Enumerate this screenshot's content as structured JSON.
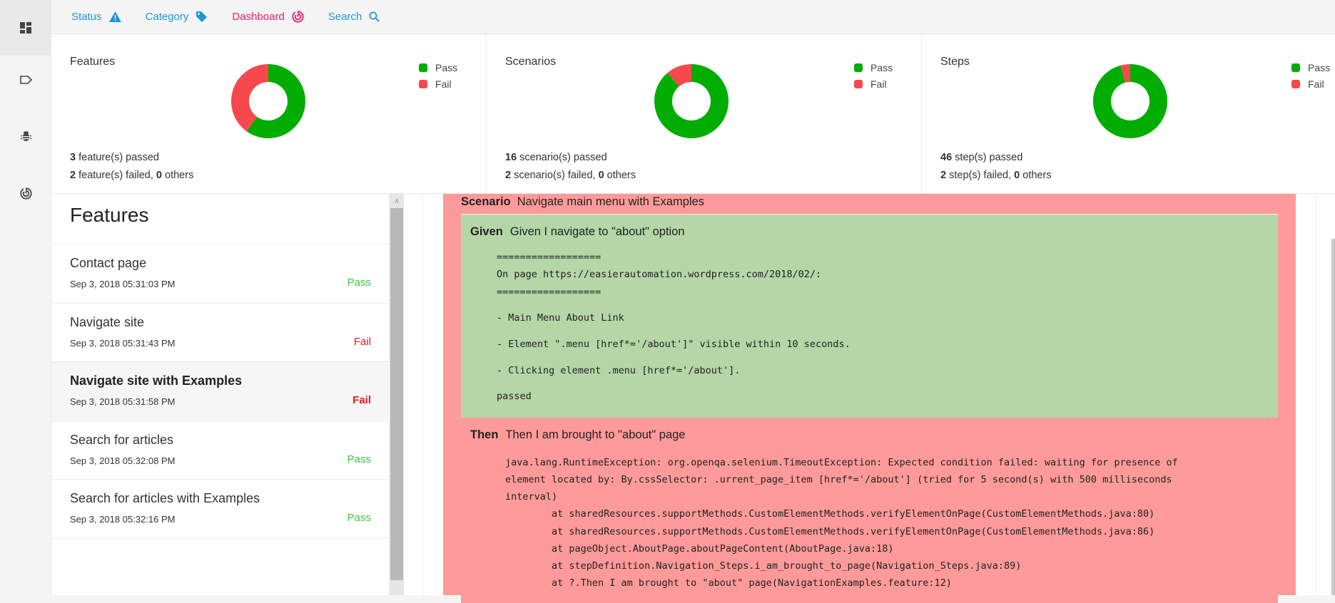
{
  "nav": {
    "items": [
      {
        "label": "Status",
        "icon": "warning-icon",
        "color": "#1e96dc"
      },
      {
        "label": "Category",
        "icon": "tag-icon",
        "color": "#1e96dc"
      },
      {
        "label": "Dashboard",
        "icon": "radar-icon",
        "color": "#e91e63"
      },
      {
        "label": "Search",
        "icon": "search-icon",
        "color": "#1e96dc"
      }
    ]
  },
  "sidebar": {
    "items": [
      {
        "icon": "dashboard-icon",
        "active": true
      },
      {
        "icon": "label-icon",
        "active": false
      },
      {
        "icon": "bug-icon",
        "active": false
      },
      {
        "icon": "radar-icon",
        "active": false
      }
    ]
  },
  "colors": {
    "pass": "#00ad00",
    "fail": "#f7484e"
  },
  "dashboard": {
    "features": {
      "title": "Features",
      "legend": [
        "Pass",
        "Fail"
      ],
      "passed": "3",
      "passed_text": " feature(s) passed",
      "failed": "2",
      "failed_text": " feature(s) failed, ",
      "others": "0",
      "others_text": " others"
    },
    "scenarios": {
      "title": "Scenarios",
      "legend": [
        "Pass",
        "Fail"
      ],
      "passed": "16",
      "passed_text": " scenario(s) passed",
      "failed": "2",
      "failed_text": " scenario(s) failed, ",
      "others": "0",
      "others_text": " others"
    },
    "steps": {
      "title": "Steps",
      "legend": [
        "Pass",
        "Fail"
      ],
      "passed": "46",
      "passed_text": " step(s) passed",
      "failed": "2",
      "failed_text": " step(s) failed, ",
      "others": "0",
      "others_text": " others"
    }
  },
  "chart_data": [
    {
      "type": "pie",
      "title": "Features",
      "categories": [
        "Pass",
        "Fail"
      ],
      "values": [
        3,
        2
      ],
      "donut": true,
      "legend": "top-right"
    },
    {
      "type": "pie",
      "title": "Scenarios",
      "categories": [
        "Pass",
        "Fail"
      ],
      "values": [
        16,
        2
      ],
      "donut": true,
      "legend": "top-right"
    },
    {
      "type": "pie",
      "title": "Steps",
      "categories": [
        "Pass",
        "Fail"
      ],
      "values": [
        46,
        2
      ],
      "donut": true,
      "legend": "top-right"
    }
  ],
  "features_panel": {
    "title": "Features",
    "items": [
      {
        "name": "Contact page",
        "date": "Sep 3, 2018 05:31:03 PM",
        "status": "Pass",
        "active": false
      },
      {
        "name": "Navigate site",
        "date": "Sep 3, 2018 05:31:43 PM",
        "status": "Fail",
        "active": false
      },
      {
        "name": "Navigate site with Examples",
        "date": "Sep 3, 2018 05:31:58 PM",
        "status": "Fail",
        "active": true
      },
      {
        "name": "Search for articles",
        "date": "Sep 3, 2018 05:32:08 PM",
        "status": "Pass",
        "active": false
      },
      {
        "name": "Search for articles with Examples",
        "date": "Sep 3, 2018 05:32:16 PM",
        "status": "Pass",
        "active": false
      }
    ]
  },
  "scenario": {
    "keyword": "Scenario",
    "name": "Navigate main menu with Examples",
    "steps": [
      {
        "keyword": "Given",
        "name": "Given I navigate to \"about\" option",
        "status": "pass",
        "log": [
          "==================",
          "On page https://easierautomation.wordpress.com/2018/02/:",
          "==================",
          "- Main Menu About Link",
          "- Element \".menu [href*='/about']\" visible within 10 seconds.",
          "- Clicking element .menu [href*='/about'].",
          "passed"
        ]
      },
      {
        "keyword": "Then",
        "name": "Then I am brought to \"about\" page",
        "status": "fail",
        "log": [
          "java.lang.RuntimeException: org.openqa.selenium.TimeoutException: Expected condition failed: waiting for presence of",
          "element located by: By.cssSelector: .urrent_page_item [href*='/about'] (tried for 5 second(s) with 500 milliseconds",
          "interval)",
          "        at sharedResources.supportMethods.CustomElementMethods.verifyElementOnPage(CustomElementMethods.java:80)",
          "        at sharedResources.supportMethods.CustomElementMethods.verifyElementOnPage(CustomElementMethods.java:86)",
          "        at pageObject.AboutPage.aboutPageContent(AboutPage.java:18)",
          "        at stepDefinition.Navigation_Steps.i_am_brought_to_page(Navigation_Steps.java:89)",
          "        at ?.Then I am brought to \"about\" page(NavigationExamples.feature:12)"
        ]
      }
    ]
  }
}
